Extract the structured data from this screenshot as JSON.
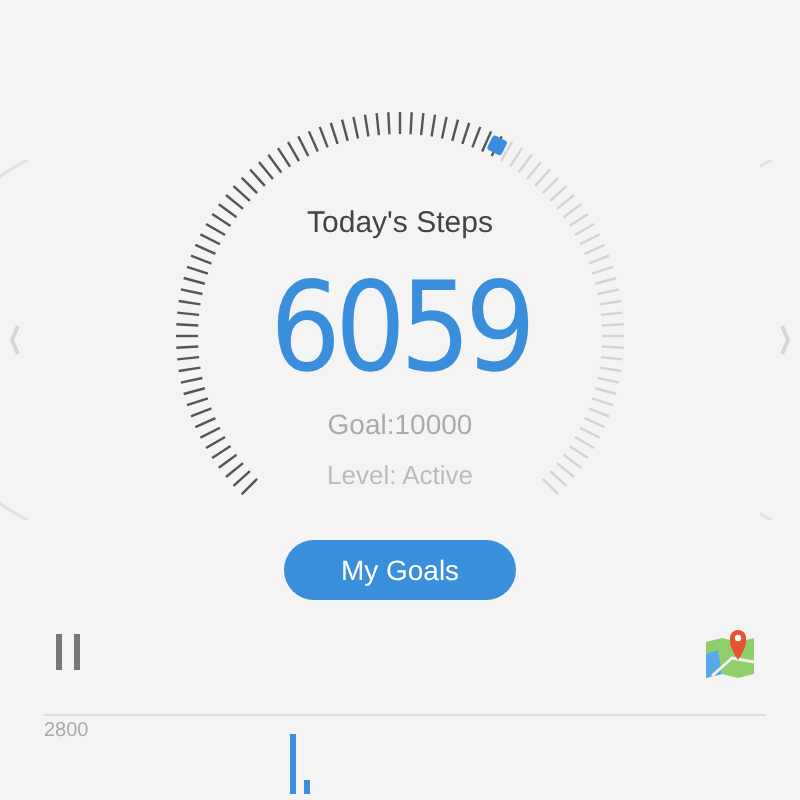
{
  "steps": {
    "title": "Today's Steps",
    "count": "6059",
    "goal": "Goal:10000",
    "level_label": "Level: Active"
  },
  "goals_button": "My Goals",
  "chart": {
    "axis_label": "2800"
  }
}
